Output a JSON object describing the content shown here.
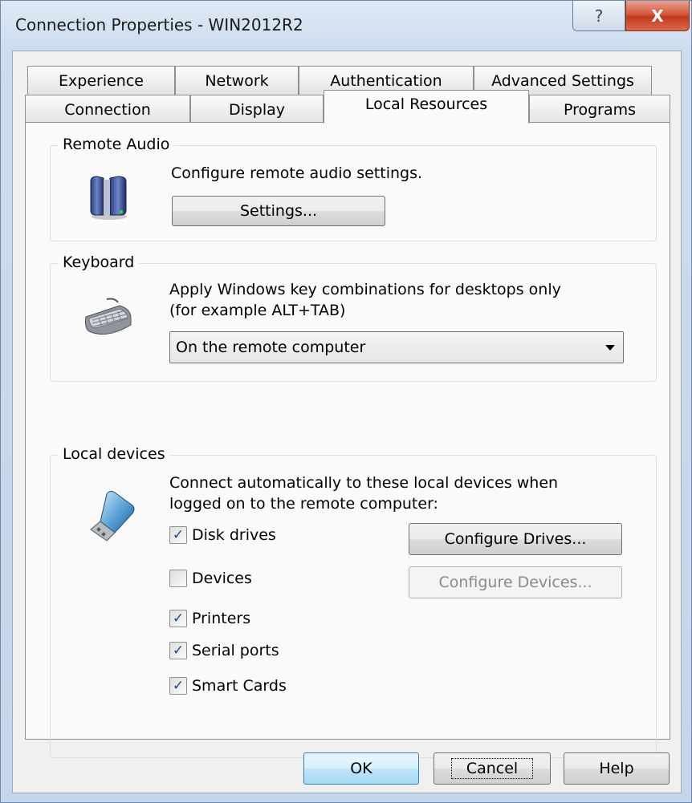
{
  "window": {
    "title": "Connection Properties - WIN2012R2",
    "help_glyph": "?",
    "close_glyph": "X"
  },
  "tabs": {
    "row1": [
      "Experience",
      "Network",
      "Authentication",
      "Advanced Settings"
    ],
    "row2": [
      "Connection",
      "Display",
      "Local Resources",
      "Programs"
    ],
    "active": "Local Resources"
  },
  "remote_audio": {
    "title": "Remote Audio",
    "description": "Configure remote audio settings.",
    "settings_button": "Settings..."
  },
  "keyboard": {
    "title": "Keyboard",
    "description_line1": "Apply Windows key combinations for desktops only",
    "description_line2": "(for example ALT+TAB)",
    "selected_option": "On the remote computer"
  },
  "local_devices": {
    "title": "Local devices",
    "description_line1": "Connect automatically to these local devices when",
    "description_line2": "logged on to the remote computer:",
    "checkboxes": [
      {
        "label": "Disk drives",
        "checked": true
      },
      {
        "label": "Devices",
        "checked": false
      },
      {
        "label": "Printers",
        "checked": true
      },
      {
        "label": "Serial ports",
        "checked": true
      },
      {
        "label": "Smart Cards",
        "checked": true
      }
    ],
    "configure_drives_button": "Configure Drives...",
    "configure_devices_button": "Configure Devices..."
  },
  "footer": {
    "ok": "OK",
    "cancel": "Cancel",
    "help": "Help"
  },
  "icons": {
    "audio": "speakers-icon",
    "keyboard": "keyboard-icon",
    "devices": "usb-drive-icon"
  }
}
